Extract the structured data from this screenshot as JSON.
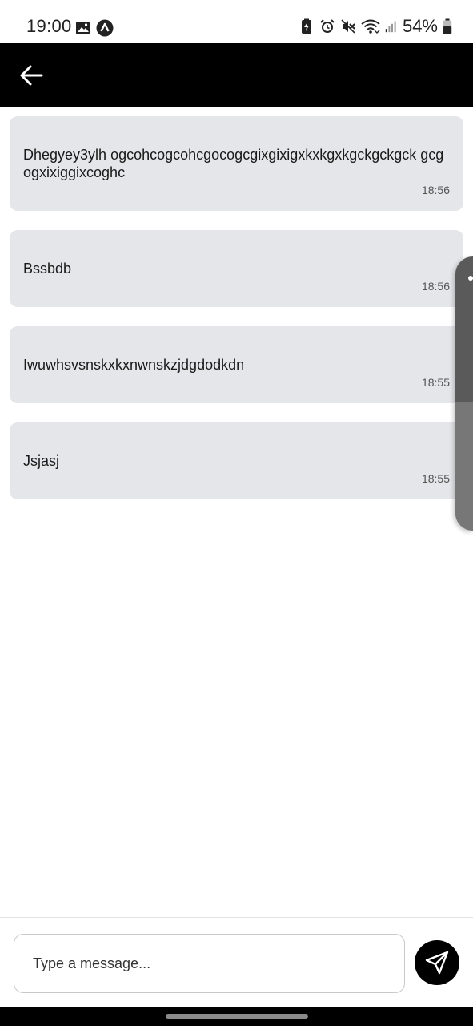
{
  "status_bar": {
    "time": "19:00",
    "battery_percent": "54%",
    "icons_left": [
      "gallery-icon",
      "app-notification-icon"
    ],
    "icons_right": [
      "battery-saver-icon",
      "alarm-icon",
      "mute-icon",
      "wifi-icon",
      "signal-icon",
      "battery-icon"
    ]
  },
  "app_bar": {
    "back_icon": "arrow-left-icon",
    "background": "#000000"
  },
  "messages": [
    {
      "text": "Dhegyey3ylh ogcohcogcohcgocogcgixgixigxkxkgxkgckgckgck gcgogxixiggixcoghc",
      "time": "18:56"
    },
    {
      "text": "Bssbdb",
      "time": "18:56"
    },
    {
      "text": "Iwuwhsvsnskxkxnwnskzjdgdodkdn",
      "time": "18:55"
    },
    {
      "text": "Jsjasj",
      "time": "18:55"
    }
  ],
  "composer": {
    "placeholder": "Type a message...",
    "value": "",
    "send_icon": "send-icon"
  },
  "colors": {
    "bubble": "#e5e6e9",
    "accent": "#000000"
  }
}
